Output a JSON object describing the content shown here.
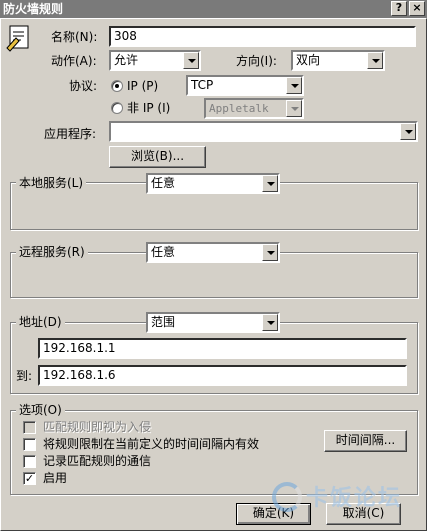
{
  "window": {
    "title": "防火墙规则",
    "help": "?",
    "close": "×"
  },
  "form": {
    "name_label": "名称(N):",
    "name_value": "308",
    "action_label": "动作(A):",
    "action_value": "允许",
    "direction_label": "方向(I):",
    "direction_value": "双向",
    "protocol_label": "协议:",
    "ip_label": "IP (P)",
    "ip_protocol_value": "TCP",
    "non_ip_label": "非 IP (I)",
    "non_ip_value": "Appletalk",
    "app_label": "应用程序:",
    "app_value": "",
    "browse_label": "浏览(B)..."
  },
  "local_service": {
    "label": "本地服务(L)",
    "value": "任意"
  },
  "remote_service": {
    "label": "远程服务(R)",
    "value": "任意"
  },
  "address": {
    "label": "地址(D)",
    "mode": "范围",
    "from_value": "192.168.1.1",
    "to_label": "到:",
    "to_value": "192.168.1.6"
  },
  "options": {
    "label": "选项(O)",
    "items": [
      {
        "label": "匹配规则即视为入侵",
        "checked": false,
        "enabled": false
      },
      {
        "label": "将规则限制在当前定义的时间间隔内有效",
        "checked": false,
        "enabled": true
      },
      {
        "label": "记录匹配规则的通信",
        "checked": false,
        "enabled": true
      },
      {
        "label": "启用",
        "checked": true,
        "enabled": true
      }
    ],
    "interval_button": "时间间隔..."
  },
  "footer": {
    "ok_label": "确定(K)",
    "cancel_label": "取消(C)"
  },
  "watermark": {
    "text": "卡饭论坛"
  }
}
